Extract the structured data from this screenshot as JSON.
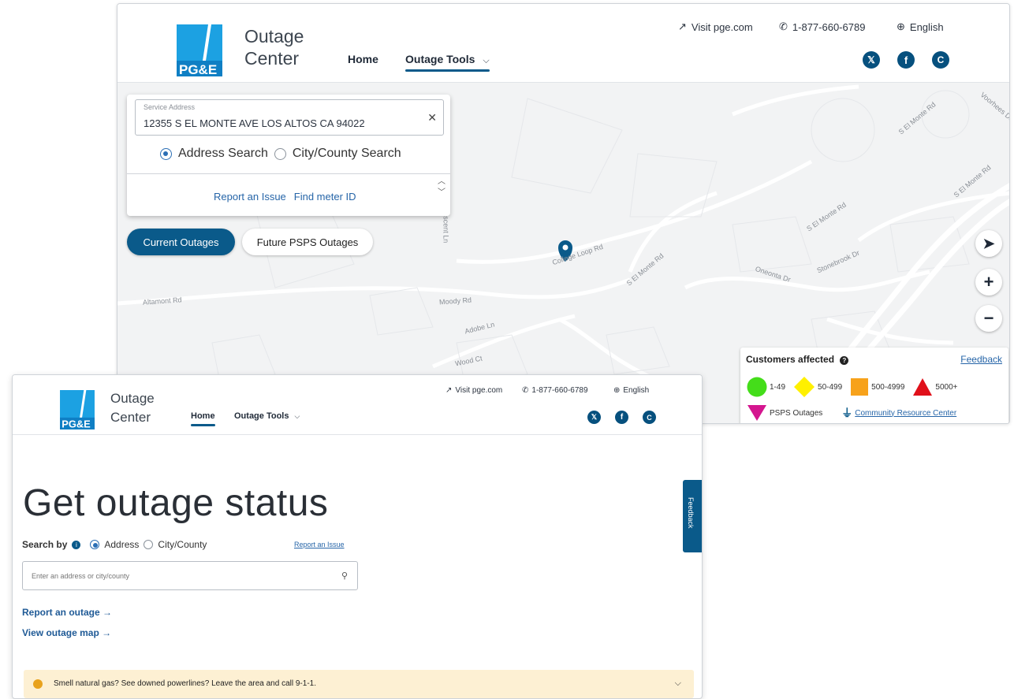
{
  "brand": {
    "line1": "Outage",
    "line2": "Center",
    "logo_text": "PG&E"
  },
  "utility": {
    "visit": "Visit pge.com",
    "phone": "1-877-660-6789",
    "language": "English"
  },
  "nav": {
    "home": "Home",
    "tools": "Outage Tools"
  },
  "social": [
    "x-icon",
    "facebook-icon",
    "c-icon"
  ],
  "map_window": {
    "address_label": "Service Address",
    "address_value": "12355 S EL MONTE AVE LOS ALTOS CA 94022",
    "radio_address": "Address Search",
    "radio_city": "City/County Search",
    "report_issue": "Report an Issue",
    "find_meter": "Find meter ID",
    "current_outages": "Current Outages",
    "future_psps": "Future PSPS Outages",
    "roads": {
      "college_loop": "College Loop Rd",
      "moody": "Moody Rd",
      "altamont": "Altamont Rd",
      "adobe": "Adobe Ln",
      "el_monte_1": "S El Monte Rd",
      "el_monte_2": "S El Monte Rd",
      "el_monte_3": "S El Monte Rd",
      "el_monte_4": "S El Monte Rd",
      "oneonta": "Oneonta Dr",
      "stonebrook": "Stonebrook Dr",
      "voorhees": "Voorhees Dr",
      "wood": "Wood Ct",
      "crescent": "Crescent Ln"
    },
    "legend": {
      "title": "Customers affected",
      "feedback": "Feedback",
      "ranges": [
        "1-49",
        "50-499",
        "500-4999",
        "5000+"
      ],
      "psps": "PSPS Outages",
      "crc": "Community Resource Center",
      "colors": {
        "green": "#44dd1a",
        "yellow": "#fff000",
        "orange": "#f7a21b",
        "red": "#e0101a",
        "magenta": "#d4168f"
      }
    }
  },
  "status_window": {
    "title": "Get outage status",
    "search_by": "Search by",
    "opt_address": "Address",
    "opt_city": "City/County",
    "report_issue": "Report an Issue",
    "placeholder": "Enter an address or city/county",
    "report_outage": "Report an outage",
    "view_map": "View outage map",
    "feedback": "Feedback",
    "alert": "Smell natural gas? See downed powerlines? Leave the area and call 9-1-1."
  },
  "colors": {
    "primary": "#0a5a8a",
    "link": "#2665a8",
    "alert_bg": "#fdf0d3"
  }
}
